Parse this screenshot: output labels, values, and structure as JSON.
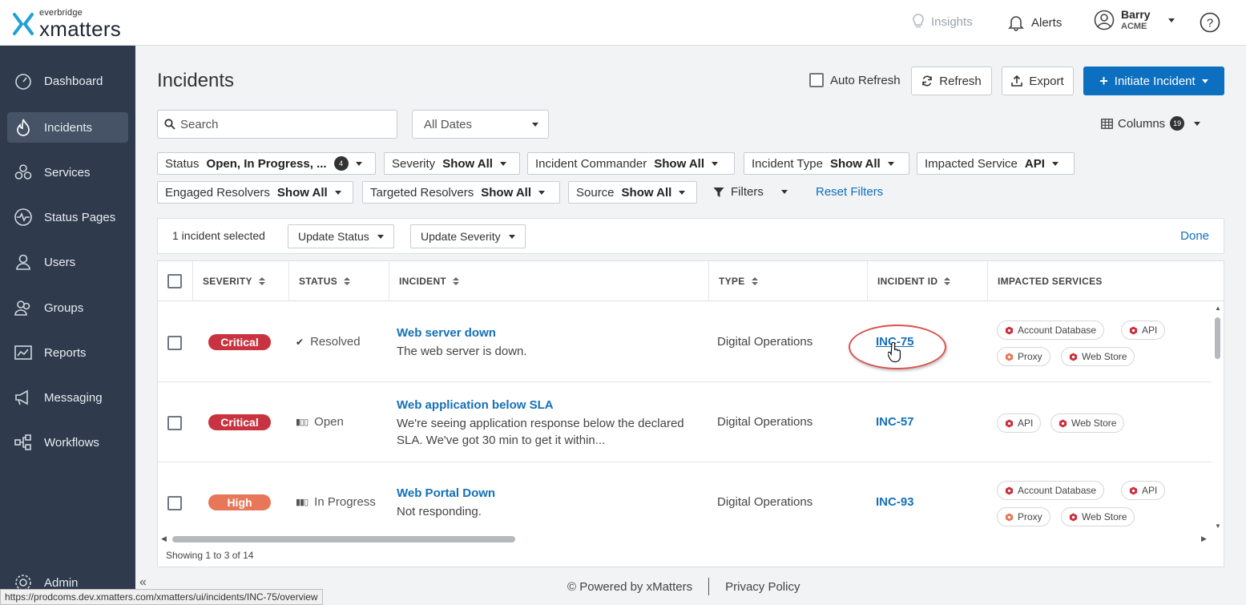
{
  "brand": {
    "sub": "everbridge",
    "name": "xmatters"
  },
  "topbar": {
    "insights": "Insights",
    "alerts": "Alerts",
    "user_name": "Barry",
    "user_org": "ACME"
  },
  "sidebar": {
    "items": [
      {
        "label": "Dashboard",
        "icon": "dashboard-icon"
      },
      {
        "label": "Incidents",
        "icon": "flame-icon",
        "active": true
      },
      {
        "label": "Services",
        "icon": "services-icon"
      },
      {
        "label": "Status Pages",
        "icon": "pulse-icon"
      },
      {
        "label": "Users",
        "icon": "user-icon"
      },
      {
        "label": "Groups",
        "icon": "groups-icon"
      },
      {
        "label": "Reports",
        "icon": "reports-icon"
      },
      {
        "label": "Messaging",
        "icon": "megaphone-icon"
      },
      {
        "label": "Workflows",
        "icon": "workflow-icon"
      }
    ],
    "admin": "Admin"
  },
  "page": {
    "title": "Incidents",
    "auto_refresh": "Auto Refresh",
    "refresh": "Refresh",
    "export": "Export",
    "initiate": "Initiate Incident",
    "search_placeholder": "Search",
    "dates": "All Dates",
    "columns": "Columns",
    "columns_count": "19"
  },
  "filters": [
    {
      "label": "Status",
      "value": "Open, In Progress, ...",
      "count": "4"
    },
    {
      "label": "Severity",
      "value": "Show All"
    },
    {
      "label": "Incident Commander",
      "value": "Show All"
    },
    {
      "label": "Incident Type",
      "value": "Show All"
    },
    {
      "label": "Impacted Service",
      "value": "API"
    },
    {
      "label": "Engaged Resolvers",
      "value": "Show All"
    },
    {
      "label": "Targeted Resolvers",
      "value": "Show All"
    },
    {
      "label": "Source",
      "value": "Show All"
    }
  ],
  "filters_more": "Filters",
  "reset_filters": "Reset Filters",
  "selection": {
    "count": "1 incident selected",
    "update_status": "Update Status",
    "update_severity": "Update Severity",
    "done": "Done"
  },
  "table": {
    "headers": [
      "SEVERITY",
      "STATUS",
      "INCIDENT",
      "TYPE",
      "INCIDENT ID",
      "IMPACTED SERVICES"
    ],
    "rows": [
      {
        "severity": "Critical",
        "severity_color": "#c9323f",
        "status": "Resolved",
        "title": "Web server down",
        "desc": "The web server is down.",
        "type": "Digital Operations",
        "id": "INC-75",
        "services": [
          "Account Database",
          "API",
          "Proxy",
          "Web Store"
        ]
      },
      {
        "severity": "Critical",
        "severity_color": "#c9323f",
        "status": "Open",
        "title": "Web application below SLA",
        "desc": "We're seeing application response below the declared SLA. We've got 30 min to get it within...",
        "type": "Digital Operations",
        "id": "INC-57",
        "services": [
          "API",
          "Web Store"
        ]
      },
      {
        "severity": "High",
        "severity_color": "#e8775a",
        "status": "In Progress",
        "title": "Web Portal Down",
        "desc": "Not responding.",
        "type": "Digital Operations",
        "id": "INC-93",
        "services": [
          "Account Database",
          "API",
          "Proxy",
          "Web Store"
        ]
      }
    ],
    "showing": "Showing 1 to 3 of 14"
  },
  "footer": {
    "powered": "© Powered by xMatters",
    "privacy": "Privacy Policy"
  },
  "status_url": "https://prodcoms.dev.xmatters.com/xmatters/ui/incidents/INC-75/overview",
  "colors": {
    "primary": "#0d6fbf",
    "sidebar": "#2f3b4c",
    "critical": "#c9323f",
    "high": "#e8775a"
  }
}
